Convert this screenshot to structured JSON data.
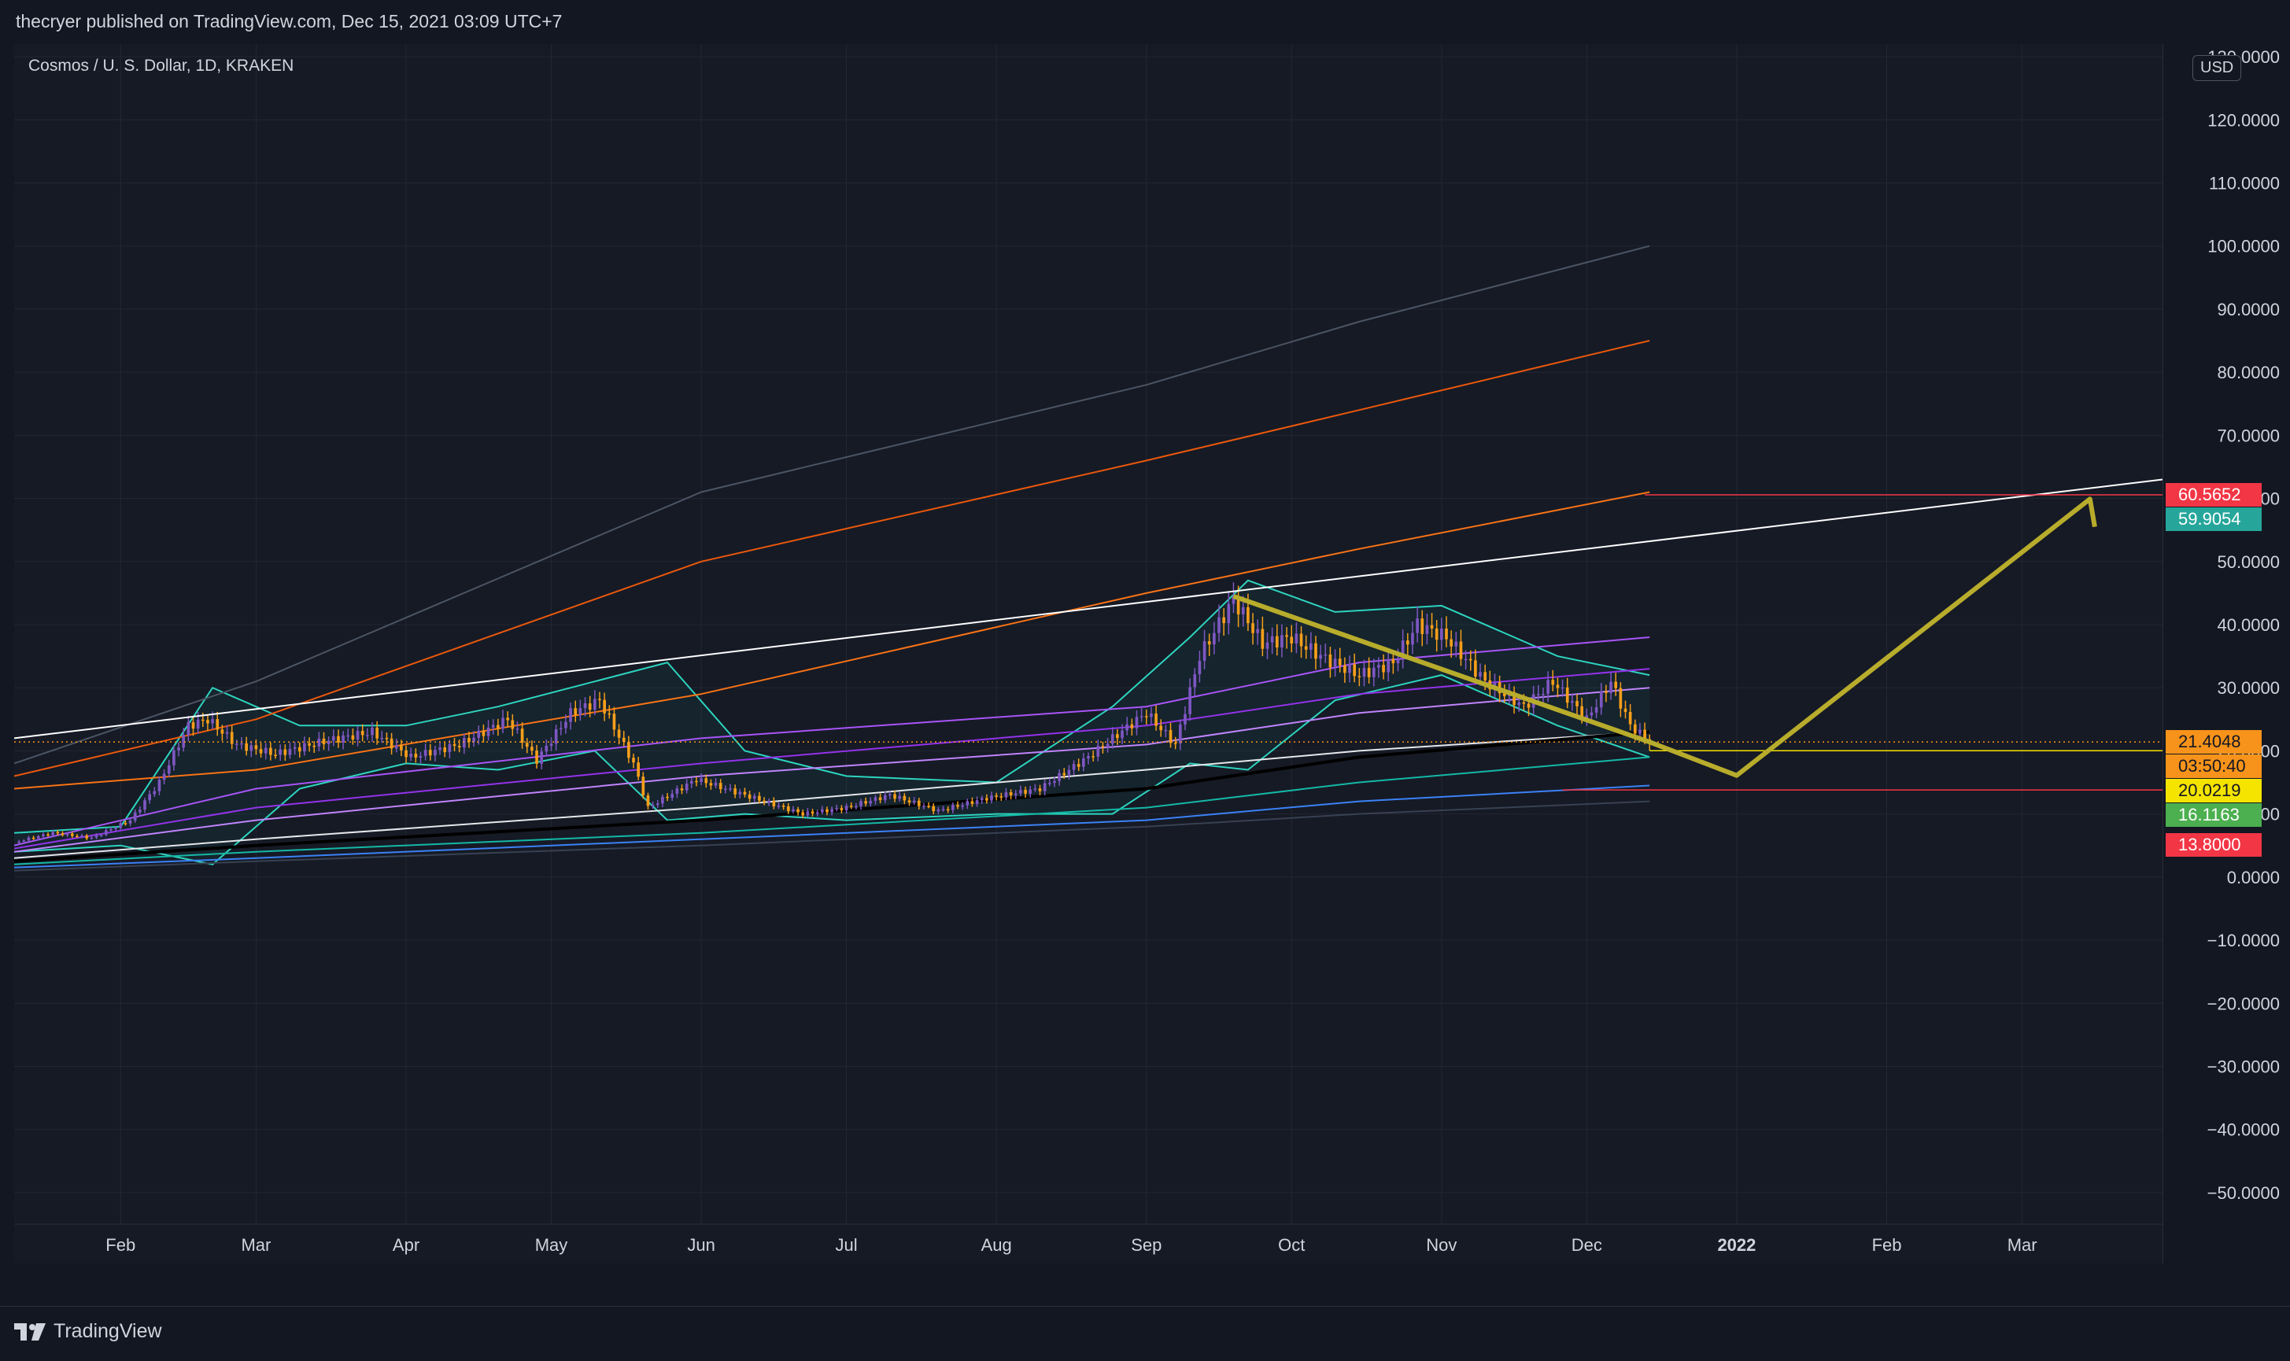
{
  "header": {
    "published": "thecryer published on TradingView.com, Dec 15, 2021 03:09 UTC+7"
  },
  "symbol": {
    "label": "Cosmos / U. S. Dollar, 1D, KRAKEN"
  },
  "currency": "USD",
  "footer": {
    "brand": "TradingView"
  },
  "colors": {
    "background": "#161a25",
    "grid": "#232734",
    "text": "#d1d4dc",
    "candle_up": "#7e57c2",
    "candle_down": "#f59e1b",
    "projection": "#b8ac2c",
    "trendline": "#ffffff"
  },
  "chart_data": {
    "type": "candlestick",
    "symbol": "Cosmos / U. S. Dollar",
    "interval": "1D",
    "exchange": "KRAKEN",
    "yaxis": {
      "unit": "USD",
      "ticks": [
        "130.0000",
        "120.0000",
        "110.0000",
        "100.0000",
        "90.0000",
        "80.0000",
        "70.0000",
        "60.0000",
        "50.0000",
        "40.0000",
        "30.0000",
        "20.0000",
        "10.0000",
        "0.0000",
        "−10.0000",
        "−20.0000",
        "−30.0000",
        "−40.0000",
        "−50.0000"
      ],
      "range": [
        -55,
        132
      ]
    },
    "xaxis": {
      "ticks": [
        {
          "label": "Feb",
          "date": "2021-02-01"
        },
        {
          "label": "Mar",
          "date": "2021-03-01"
        },
        {
          "label": "Apr",
          "date": "2021-04-01"
        },
        {
          "label": "May",
          "date": "2021-05-01"
        },
        {
          "label": "Jun",
          "date": "2021-06-01"
        },
        {
          "label": "Jul",
          "date": "2021-07-01"
        },
        {
          "label": "Aug",
          "date": "2021-08-01"
        },
        {
          "label": "Sep",
          "date": "2021-09-01"
        },
        {
          "label": "Oct",
          "date": "2021-10-01"
        },
        {
          "label": "Nov",
          "date": "2021-11-01"
        },
        {
          "label": "Dec",
          "date": "2021-12-01"
        },
        {
          "label": "2022",
          "date": "2022-01-01",
          "bold": true
        },
        {
          "label": "Feb",
          "date": "2022-02-01"
        },
        {
          "label": "Mar",
          "date": "2022-03-01"
        }
      ],
      "range": [
        "2021-01-10",
        "2022-03-30"
      ]
    },
    "price_path": [
      [
        "2021-01-10",
        5.5
      ],
      [
        "2021-01-18",
        7.0
      ],
      [
        "2021-01-26",
        6.2
      ],
      [
        "2021-02-03",
        9.0
      ],
      [
        "2021-02-09",
        15.0
      ],
      [
        "2021-02-15",
        24.0
      ],
      [
        "2021-02-19",
        25.0
      ],
      [
        "2021-02-25",
        21.0
      ],
      [
        "2021-03-05",
        19.5
      ],
      [
        "2021-03-15",
        21.5
      ],
      [
        "2021-03-25",
        23.0
      ],
      [
        "2021-04-02",
        19.0
      ],
      [
        "2021-04-12",
        21.0
      ],
      [
        "2021-04-22",
        25.0
      ],
      [
        "2021-04-28",
        18.5
      ],
      [
        "2021-05-05",
        26.0
      ],
      [
        "2021-05-11",
        28.0
      ],
      [
        "2021-05-18",
        18.0
      ],
      [
        "2021-05-21",
        11.0
      ],
      [
        "2021-05-31",
        15.5
      ],
      [
        "2021-06-10",
        13.0
      ],
      [
        "2021-06-22",
        10.0
      ],
      [
        "2021-07-01",
        11.0
      ],
      [
        "2021-07-10",
        13.0
      ],
      [
        "2021-07-20",
        10.5
      ],
      [
        "2021-07-30",
        12.5
      ],
      [
        "2021-08-10",
        14.0
      ],
      [
        "2021-08-20",
        19.0
      ],
      [
        "2021-08-25",
        22.0
      ],
      [
        "2021-09-01",
        26.0
      ],
      [
        "2021-09-07",
        21.0
      ],
      [
        "2021-09-12",
        35.0
      ],
      [
        "2021-09-19",
        44.0
      ],
      [
        "2021-09-25",
        37.0
      ],
      [
        "2021-10-01",
        38.0
      ],
      [
        "2021-10-07",
        35.0
      ],
      [
        "2021-10-15",
        32.0
      ],
      [
        "2021-10-22",
        34.0
      ],
      [
        "2021-10-27",
        40.0
      ],
      [
        "2021-11-02",
        38.0
      ],
      [
        "2021-11-10",
        31.0
      ],
      [
        "2021-11-18",
        27.0
      ],
      [
        "2021-11-24",
        31.0
      ],
      [
        "2021-12-01",
        25.0
      ],
      [
        "2021-12-06",
        31.0
      ],
      [
        "2021-12-10",
        24.0
      ],
      [
        "2021-12-14",
        21.4
      ]
    ],
    "bands": {
      "upper": [
        [
          "2021-01-10",
          7
        ],
        [
          "2021-02-01",
          8
        ],
        [
          "2021-02-20",
          30
        ],
        [
          "2021-03-10",
          24
        ],
        [
          "2021-04-01",
          24
        ],
        [
          "2021-04-20",
          27
        ],
        [
          "2021-05-10",
          31
        ],
        [
          "2021-05-25",
          34
        ],
        [
          "2021-06-10",
          20
        ],
        [
          "2021-07-01",
          16
        ],
        [
          "2021-08-01",
          15
        ],
        [
          "2021-08-25",
          27
        ],
        [
          "2021-09-10",
          38
        ],
        [
          "2021-09-22",
          47
        ],
        [
          "2021-10-10",
          42
        ],
        [
          "2021-11-01",
          43
        ],
        [
          "2021-11-25",
          35
        ],
        [
          "2021-12-14",
          32
        ]
      ],
      "lower": [
        [
          "2021-01-10",
          4
        ],
        [
          "2021-02-01",
          5
        ],
        [
          "2021-02-20",
          2
        ],
        [
          "2021-03-10",
          14
        ],
        [
          "2021-04-01",
          18
        ],
        [
          "2021-04-20",
          17
        ],
        [
          "2021-05-10",
          20
        ],
        [
          "2021-05-25",
          9
        ],
        [
          "2021-06-10",
          10
        ],
        [
          "2021-07-01",
          9
        ],
        [
          "2021-08-01",
          10
        ],
        [
          "2021-08-25",
          10
        ],
        [
          "2021-09-10",
          18
        ],
        [
          "2021-09-22",
          17
        ],
        [
          "2021-10-10",
          28
        ],
        [
          "2021-11-01",
          32
        ],
        [
          "2021-11-25",
          24
        ],
        [
          "2021-12-14",
          19
        ]
      ]
    },
    "moving_averages": [
      {
        "color": "#a855f7",
        "points": [
          [
            "2021-01-10",
            5
          ],
          [
            "2021-03-01",
            14
          ],
          [
            "2021-06-01",
            22
          ],
          [
            "2021-09-01",
            27
          ],
          [
            "2021-10-15",
            34
          ],
          [
            "2021-12-14",
            38
          ]
        ]
      },
      {
        "color": "#9333ea",
        "points": [
          [
            "2021-01-10",
            4.5
          ],
          [
            "2021-03-01",
            11
          ],
          [
            "2021-06-01",
            18
          ],
          [
            "2021-09-01",
            24
          ],
          [
            "2021-10-15",
            29
          ],
          [
            "2021-12-14",
            33
          ]
        ]
      },
      {
        "color": "#c084fc",
        "points": [
          [
            "2021-01-10",
            4
          ],
          [
            "2021-03-01",
            9
          ],
          [
            "2021-06-01",
            16
          ],
          [
            "2021-09-01",
            21
          ],
          [
            "2021-10-15",
            26
          ],
          [
            "2021-12-14",
            30
          ]
        ]
      },
      {
        "color": "#e5e7eb",
        "points": [
          [
            "2021-01-10",
            3
          ],
          [
            "2021-03-01",
            6
          ],
          [
            "2021-06-01",
            11
          ],
          [
            "2021-09-01",
            17
          ],
          [
            "2021-10-15",
            20
          ],
          [
            "2021-12-14",
            23
          ]
        ]
      },
      {
        "color": "#000000",
        "points": [
          [
            "2021-01-10",
            2.5
          ],
          [
            "2021-03-01",
            5
          ],
          [
            "2021-06-01",
            9
          ],
          [
            "2021-09-01",
            14
          ],
          [
            "2021-10-15",
            19
          ],
          [
            "2021-12-14",
            23
          ]
        ]
      },
      {
        "color": "#14b8a6",
        "points": [
          [
            "2021-01-10",
            2
          ],
          [
            "2021-03-01",
            4
          ],
          [
            "2021-06-01",
            7
          ],
          [
            "2021-09-01",
            11
          ],
          [
            "2021-10-15",
            15
          ],
          [
            "2021-12-14",
            19
          ]
        ]
      },
      {
        "color": "#3b82f6",
        "points": [
          [
            "2021-01-10",
            1.5
          ],
          [
            "2021-03-01",
            3
          ],
          [
            "2021-06-01",
            6
          ],
          [
            "2021-09-01",
            9
          ],
          [
            "2021-10-15",
            12
          ],
          [
            "2021-12-14",
            14.5
          ]
        ]
      },
      {
        "color": "#374151",
        "points": [
          [
            "2021-01-10",
            1
          ],
          [
            "2021-03-01",
            2.5
          ],
          [
            "2021-06-01",
            5
          ],
          [
            "2021-09-01",
            8
          ],
          [
            "2021-10-15",
            10
          ],
          [
            "2021-12-14",
            12
          ]
        ]
      },
      {
        "color": "#f97316",
        "points": [
          [
            "2021-01-10",
            14
          ],
          [
            "2021-03-01",
            17
          ],
          [
            "2021-06-01",
            29
          ],
          [
            "2021-09-01",
            45
          ],
          [
            "2021-10-15",
            52
          ],
          [
            "2021-12-14",
            61
          ]
        ]
      },
      {
        "color": "#ea580c",
        "points": [
          [
            "2021-01-10",
            16
          ],
          [
            "2021-03-01",
            25
          ],
          [
            "2021-06-01",
            50
          ],
          [
            "2021-09-01",
            66
          ],
          [
            "2021-10-15",
            74
          ],
          [
            "2021-12-14",
            85
          ]
        ]
      },
      {
        "color": "#4b5563",
        "points": [
          [
            "2021-01-10",
            18
          ],
          [
            "2021-03-01",
            31
          ],
          [
            "2021-06-01",
            61
          ],
          [
            "2021-09-01",
            78
          ],
          [
            "2021-10-15",
            88
          ],
          [
            "2021-12-14",
            100
          ]
        ]
      }
    ],
    "drawings": {
      "trendline": [
        [
          "2021-01-10",
          22
        ],
        [
          "2022-03-30",
          63
        ]
      ],
      "projection": [
        [
          "2021-09-19",
          44.5
        ],
        [
          "2021-12-14",
          21.4
        ],
        [
          "2022-01-01",
          16.1
        ],
        [
          "2022-03-15",
          59.9
        ],
        [
          "2022-03-16",
          55.5
        ]
      ],
      "resistance": {
        "value": 60.5652,
        "from": "2021-12-13",
        "to": "2022-03-30"
      },
      "support": {
        "value": 13.8,
        "from": "2021-11-26",
        "to": "2022-03-30"
      },
      "current_line": {
        "value": 21.4048
      }
    },
    "price_labels": [
      {
        "value": "60.5652",
        "bg": "#f23645",
        "fg": "#ffffff",
        "y": 60.5652
      },
      {
        "value": "59.9054",
        "bg": "#26a69a",
        "fg": "#ffffff",
        "y": 59.9054
      },
      {
        "value": "21.4048",
        "bg": "#f7931a",
        "fg": "#131722",
        "y": 21.4048
      },
      {
        "value": "03:50:40",
        "bg": "#f7931a",
        "fg": "#131722",
        "y": 18.9
      },
      {
        "value": "20.0219",
        "bg": "#f5e400",
        "fg": "#131722",
        "y": 15.4
      },
      {
        "value": "16.1163",
        "bg": "#4caf50",
        "fg": "#ffffff",
        "y": 10.1
      },
      {
        "value": "13.8000",
        "bg": "#f23645",
        "fg": "#ffffff",
        "y": 5.1
      }
    ]
  }
}
